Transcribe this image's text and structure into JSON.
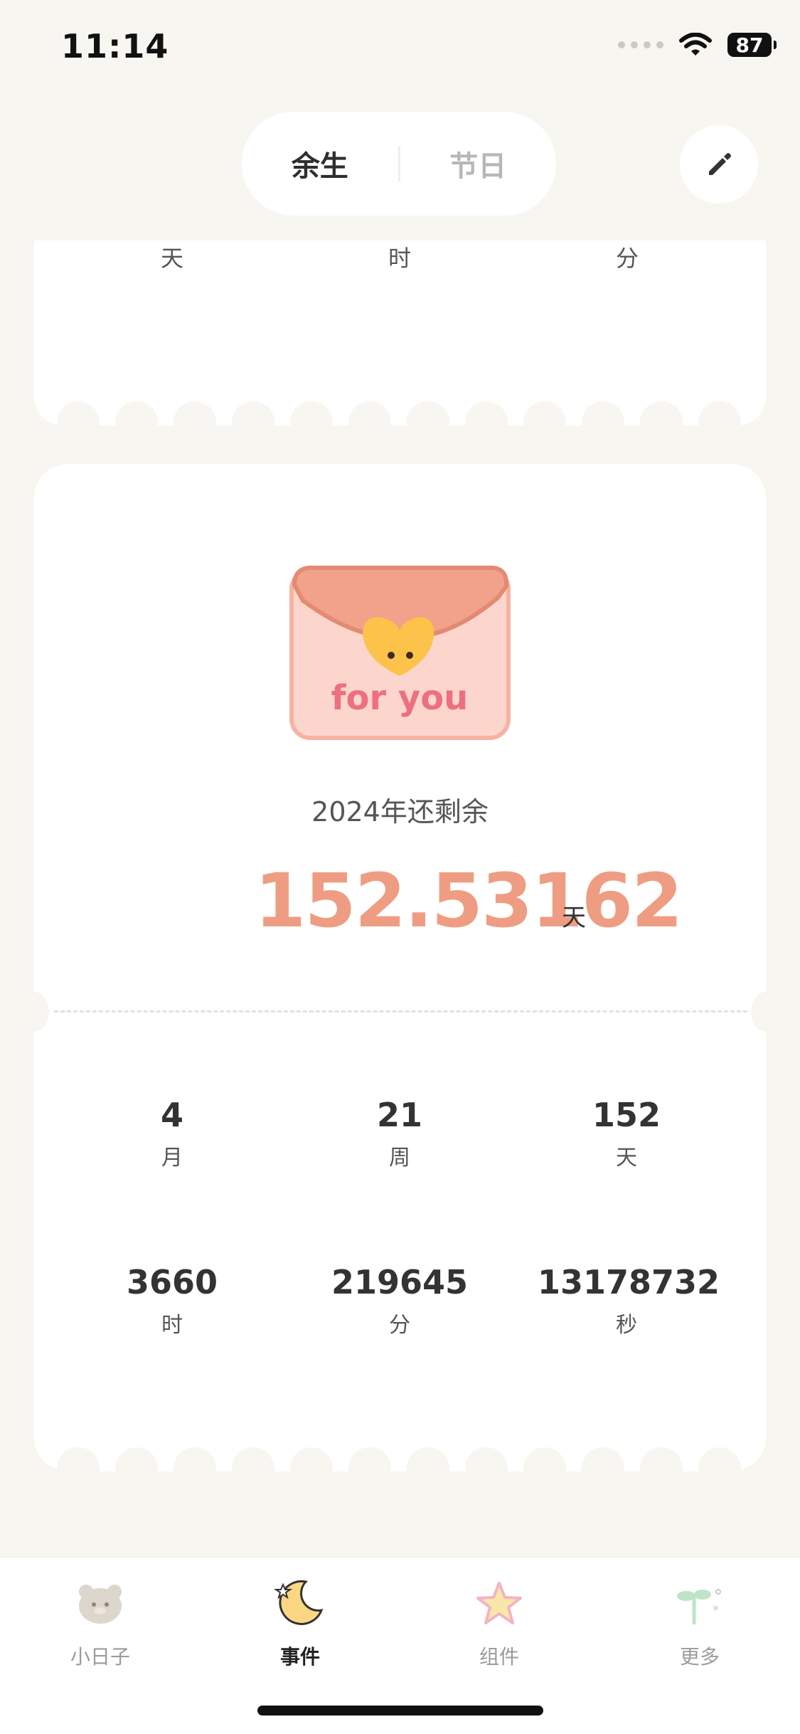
{
  "status_bar": {
    "time": "11:14",
    "battery": "87"
  },
  "header": {
    "segments": [
      {
        "label": "余生",
        "active": true
      },
      {
        "label": "节日",
        "active": false
      }
    ],
    "edit_icon": "pencil-icon"
  },
  "top_card": {
    "units": [
      "天",
      "时",
      "分"
    ]
  },
  "main_card": {
    "illustration": "envelope-for-you",
    "illustration_text": "for you",
    "title": "2024年还剩余",
    "value": "152.53162",
    "unit": "天",
    "stats": [
      {
        "value": "4",
        "label": "月"
      },
      {
        "value": "21",
        "label": "周"
      },
      {
        "value": "152",
        "label": "天"
      },
      {
        "value": "3660",
        "label": "时"
      },
      {
        "value": "219645",
        "label": "分"
      },
      {
        "value": "13178732",
        "label": "秒"
      }
    ]
  },
  "tabbar": {
    "tabs": [
      {
        "label": "小日子",
        "icon": "bear-icon",
        "active": false
      },
      {
        "label": "事件",
        "icon": "moon-icon",
        "active": true
      },
      {
        "label": "组件",
        "icon": "star-icon",
        "active": false
      },
      {
        "label": "更多",
        "icon": "sprout-icon",
        "active": false
      }
    ]
  },
  "colors": {
    "background": "#f7f6f0",
    "accent": "#ee9d82"
  }
}
